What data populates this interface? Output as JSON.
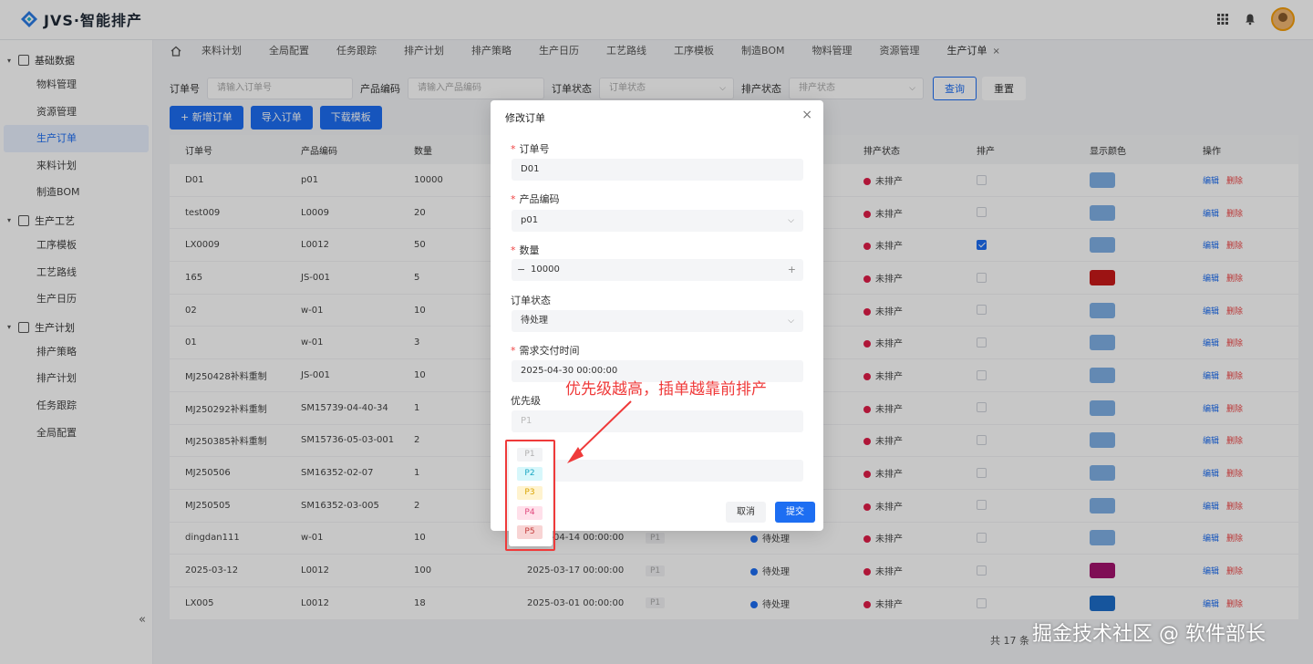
{
  "app": {
    "title": "JVS·智能排产",
    "brand_color": "#1d6ef2"
  },
  "topbar": {
    "icons": [
      "grid-icon",
      "bell-icon",
      "avatar"
    ]
  },
  "sidebar": {
    "groups": [
      {
        "label": "基础数据",
        "items": [
          "物料管理",
          "资源管理",
          "生产订单",
          "来料计划",
          "制造BOM"
        ]
      },
      {
        "label": "生产工艺",
        "items": [
          "工序模板",
          "工艺路线",
          "生产日历"
        ]
      },
      {
        "label": "生产计划",
        "items": [
          "排产策略",
          "排产计划",
          "任务跟踪",
          "全局配置"
        ]
      }
    ],
    "active_item": "生产订单",
    "collapse_label": "«"
  },
  "tabs": {
    "items": [
      "来料计划",
      "全局配置",
      "任务跟踪",
      "排产计划",
      "排产策略",
      "生产日历",
      "工艺路线",
      "工序模板",
      "制造BOM",
      "物料管理",
      "资源管理",
      "生产订单"
    ],
    "active": "生产订单",
    "close_label": "×"
  },
  "filters": {
    "order_no_label": "订单号",
    "order_no_placeholder": "请输入订单号",
    "product_code_label": "产品编码",
    "product_code_placeholder": "请输入产品编码",
    "order_status_label": "订单状态",
    "order_status_placeholder": "订单状态",
    "schedule_status_label": "排产状态",
    "schedule_status_placeholder": "排产状态",
    "query_label": "查询",
    "reset_label": "重置"
  },
  "actions": {
    "add_label": "+ 新增订单",
    "import_label": "导入订单",
    "download_label": "下载模板"
  },
  "table": {
    "headers": [
      "订单号",
      "产品编码",
      "数量",
      "",
      "",
      "",
      "排产状态",
      "排产",
      "显示颜色",
      "操作"
    ],
    "edit_label": "编辑",
    "delete_label": "删除",
    "rows": [
      {
        "order_no": "D01",
        "product": "p01",
        "qty": "10000",
        "due": "",
        "priority": "",
        "order_status": "",
        "sched_status": "未排产",
        "scheduled": false,
        "color": "#7fb0e6"
      },
      {
        "order_no": "test009",
        "product": "L0009",
        "qty": "20",
        "due": "",
        "priority": "",
        "order_status": "",
        "sched_status": "未排产",
        "scheduled": false,
        "color": "#7fb0e6"
      },
      {
        "order_no": "LX0009",
        "product": "L0012",
        "qty": "50",
        "due": "",
        "priority": "",
        "order_status": "",
        "sched_status": "未排产",
        "scheduled": true,
        "color": "#7fb0e6"
      },
      {
        "order_no": "165",
        "product": "JS-001",
        "qty": "5",
        "due": "",
        "priority": "",
        "order_status": "",
        "sched_status": "未排产",
        "scheduled": false,
        "color": "#c81919"
      },
      {
        "order_no": "02",
        "product": "w-01",
        "qty": "10",
        "due": "",
        "priority": "",
        "order_status": "",
        "sched_status": "未排产",
        "scheduled": false,
        "color": "#7fb0e6"
      },
      {
        "order_no": "01",
        "product": "w-01",
        "qty": "3",
        "due": "",
        "priority": "",
        "order_status": "",
        "sched_status": "未排产",
        "scheduled": false,
        "color": "#7fb0e6"
      },
      {
        "order_no": "MJ250428补料重制",
        "product": "JS-001",
        "qty": "10",
        "due": "",
        "priority": "",
        "order_status": "",
        "sched_status": "未排产",
        "scheduled": false,
        "color": "#7fb0e6"
      },
      {
        "order_no": "MJ250292补料重制",
        "product": "SM15739-04-40-34",
        "qty": "1",
        "due": "",
        "priority": "",
        "order_status": "",
        "sched_status": "未排产",
        "scheduled": false,
        "color": "#7fb0e6"
      },
      {
        "order_no": "MJ250385补料重制",
        "product": "SM15736-05-03-001",
        "qty": "2",
        "due": "",
        "priority": "",
        "order_status": "",
        "sched_status": "未排产",
        "scheduled": false,
        "color": "#7fb0e6"
      },
      {
        "order_no": "MJ250506",
        "product": "SM16352-02-07",
        "qty": "1",
        "due": "",
        "priority": "",
        "order_status": "",
        "sched_status": "未排产",
        "scheduled": false,
        "color": "#7fb0e6"
      },
      {
        "order_no": "MJ250505",
        "product": "SM16352-03-005",
        "qty": "2",
        "due": "",
        "priority": "",
        "order_status": "",
        "sched_status": "未排产",
        "scheduled": false,
        "color": "#7fb0e6"
      },
      {
        "order_no": "dingdan111",
        "product": "w-01",
        "qty": "10",
        "due": "2025-04-14 00:00:00",
        "priority": "P1",
        "order_status": "待处理",
        "sched_status": "未排产",
        "scheduled": false,
        "color": "#7fb0e6"
      },
      {
        "order_no": "2025-03-12",
        "product": "L0012",
        "qty": "100",
        "due": "2025-03-17 00:00:00",
        "priority": "P1",
        "order_status": "待处理",
        "sched_status": "未排产",
        "scheduled": false,
        "color": "#a3136e"
      },
      {
        "order_no": "LX005",
        "product": "L0012",
        "qty": "18",
        "due": "2025-03-01 00:00:00",
        "priority": "P1",
        "order_status": "待处理",
        "sched_status": "未排产",
        "scheduled": false,
        "color": "#1d6ec9"
      }
    ],
    "pager_label": "共 17 条"
  },
  "dialog": {
    "title": "修改订单",
    "close_label": "×",
    "order_no_label": "订单号",
    "order_no_value": "D01",
    "product_label": "产品编码",
    "product_value": "p01",
    "qty_label": "数量",
    "qty_value": "10000",
    "qty_minus": "−",
    "qty_plus": "+",
    "status_label": "订单状态",
    "status_value": "待处理",
    "due_label": "需求交付时间",
    "due_value": "2025-04-30 00:00:00",
    "priority_label": "优先级",
    "priority_value": "P1",
    "cancel_label": "取消",
    "submit_label": "提交"
  },
  "priority_dropdown": {
    "options": [
      {
        "label": "P1",
        "bg": "#f2f3f5",
        "fg": "#b0b0b0"
      },
      {
        "label": "P2",
        "bg": "#d7f7fb",
        "fg": "#1aa7c2"
      },
      {
        "label": "P3",
        "bg": "#fff3cf",
        "fg": "#d9a400"
      },
      {
        "label": "P4",
        "bg": "#ffe0ea",
        "fg": "#e0487d"
      },
      {
        "label": "P5",
        "bg": "#f8d4d4",
        "fg": "#c43b3b"
      }
    ]
  },
  "annotation": {
    "text": "优先级越高，插单越靠前排产",
    "color": "#ef3a3a"
  },
  "watermark": {
    "text": "掘金技术社区 @ 软件部长"
  }
}
